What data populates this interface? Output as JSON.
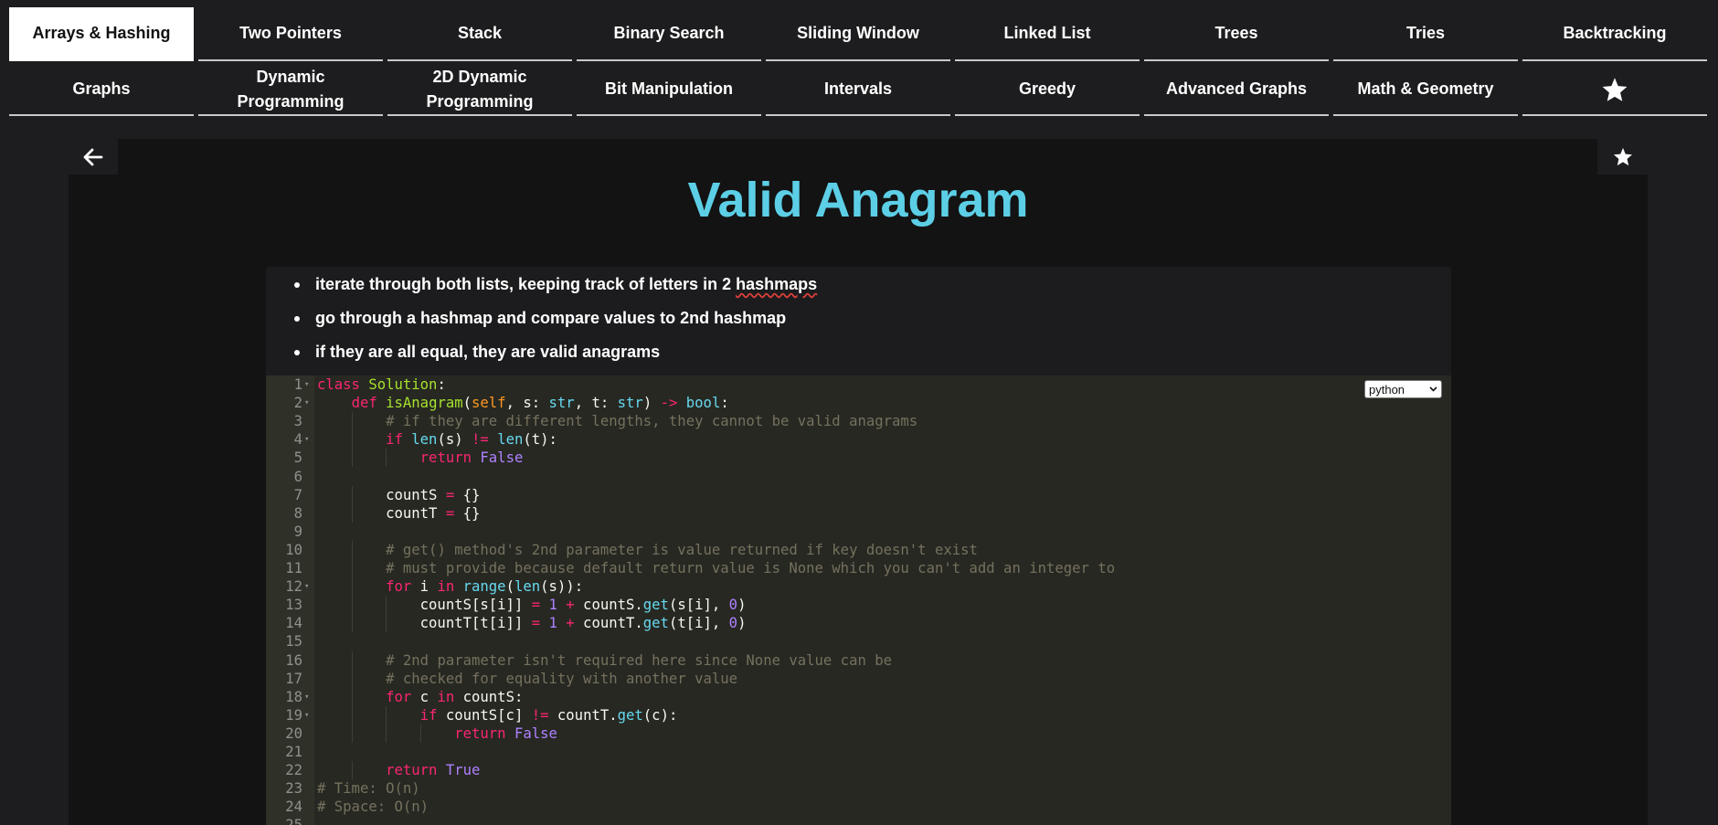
{
  "nav": {
    "row1": [
      {
        "label": "Arrays & Hashing",
        "active": true
      },
      {
        "label": "Two Pointers"
      },
      {
        "label": "Stack"
      },
      {
        "label": "Binary Search"
      },
      {
        "label": "Sliding Window"
      },
      {
        "label": "Linked List"
      },
      {
        "label": "Trees"
      },
      {
        "label": "Tries"
      },
      {
        "label": "Backtracking"
      }
    ],
    "row2": [
      {
        "label": "Graphs"
      },
      {
        "label": "Dynamic Programming"
      },
      {
        "label": "2D Dynamic Programming"
      },
      {
        "label": "Bit Manipulation"
      },
      {
        "label": "Intervals"
      },
      {
        "label": "Greedy"
      },
      {
        "label": "Advanced Graphs"
      },
      {
        "label": "Math & Geometry"
      },
      {
        "label": "",
        "icon": "star-icon"
      }
    ]
  },
  "problem": {
    "title": "Valid Anagram",
    "notes": [
      {
        "before": "iterate through both lists, keeping track of letters in 2 ",
        "squiggle": "hashmaps"
      },
      {
        "before": "go through a hashmap and compare values to 2nd hashmap",
        "squiggle": ""
      },
      {
        "before": "if they are all equal, they are valid anagrams",
        "squiggle": ""
      }
    ]
  },
  "editor": {
    "language": "python",
    "lines": [
      "class Solution:",
      "    def isAnagram(self, s: str, t: str) -> bool:",
      "        # if they are different lengths, they cannot be valid anagrams",
      "        if len(s) != len(t):",
      "            return False",
      "",
      "        countS = {}",
      "        countT = {}",
      "",
      "        # get() method's 2nd parameter is value returned if key doesn't exist",
      "        # must provide because default return value is None which you can't add an integer to",
      "        for i in range(len(s)):",
      "            countS[s[i]] = 1 + countS.get(s[i], 0)",
      "            countT[t[i]] = 1 + countT.get(t[i], 0)",
      "",
      "        # 2nd parameter isn't required here since None value can be",
      "        # checked for equality with another value",
      "        for c in countS:",
      "            if countS[c] != countT.get(c):",
      "                return False",
      "",
      "        return True",
      "# Time: O(n)",
      "# Space: O(n)",
      ""
    ],
    "fold_lines": [
      1,
      2,
      4,
      12,
      18,
      19
    ]
  },
  "icons": {
    "back": "arrow-left-icon",
    "favorite": "star-icon",
    "nav_extra": "star-icon",
    "select_caret": "chevron-down-icon"
  },
  "colors": {
    "accent_title": "#5ccfe6",
    "editor_bg": "#272822",
    "keyword": "#f92672",
    "function": "#a6e22e",
    "builtin": "#66d9ef",
    "constant": "#ae81ff",
    "comment": "#75715e"
  }
}
